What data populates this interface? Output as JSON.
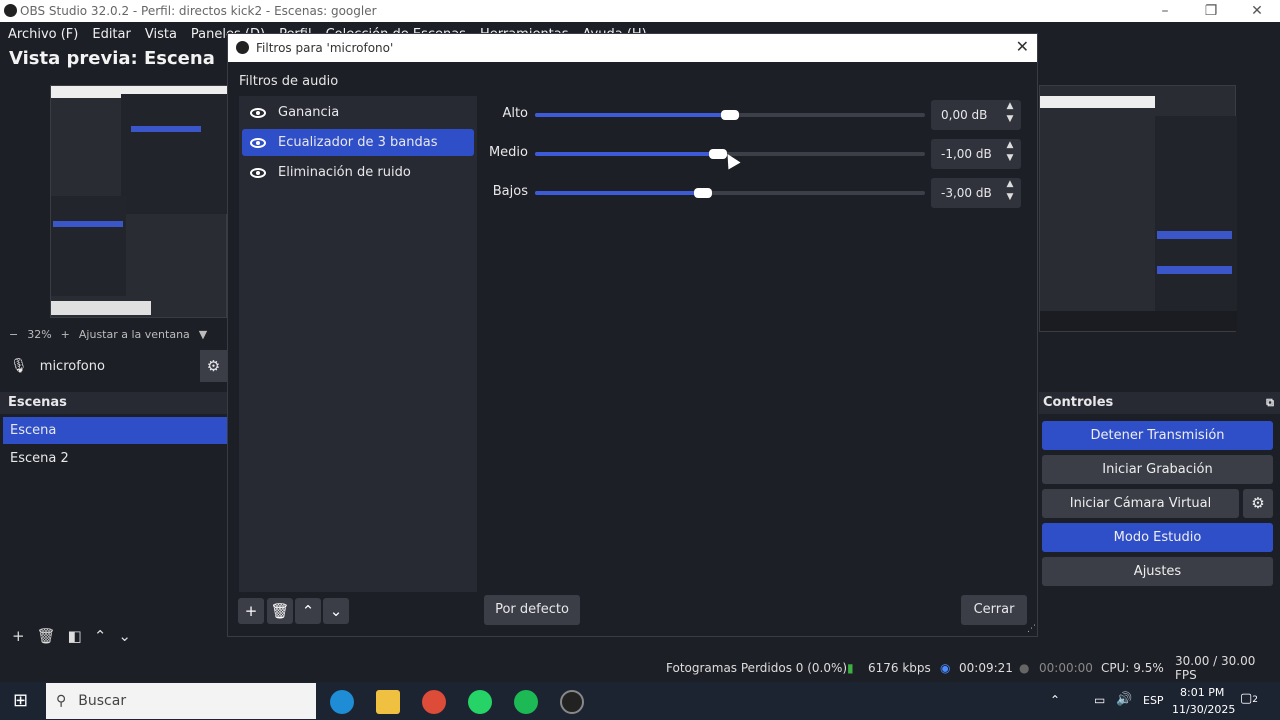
{
  "window": {
    "title": "OBS Studio 32.0.2 - Perfil: directos kick2 - Escenas: googler"
  },
  "menu": [
    "Archivo (F)",
    "Editar",
    "Vista",
    "Paneles (D)",
    "Perfil",
    "Colección de Escenas",
    "Herramientas",
    "Ayuda (H)"
  ],
  "preview": {
    "title": "Vista previa: Escena"
  },
  "zoom": {
    "minus": "−",
    "value": "32%",
    "plus": "+",
    "fit_label": "Ajustar a la ventana"
  },
  "source": {
    "name": "microfono"
  },
  "scenes": {
    "header": "Escenas",
    "items": [
      "Escena",
      "Escena 2"
    ],
    "selected": 0
  },
  "controls": {
    "header": "Controles",
    "buttons": [
      "Detener Transmisión",
      "Iniciar Grabación",
      "Iniciar Cámara Virtual",
      "Modo Estudio",
      "Ajustes"
    ]
  },
  "status": {
    "dropped": "Fotogramas Perdidos 0 (0.0%)",
    "bitrate": "6176 kbps",
    "live_time": "00:09:21",
    "rec_time": "00:00:00",
    "cpu": "CPU: 9.5%",
    "fps": "30.00 / 30.00 FPS"
  },
  "taskbar": {
    "search_placeholder": "Buscar",
    "lang": "ESP",
    "time": "8:01 PM",
    "date": "11/30/2025",
    "notif_count": "2"
  },
  "dialog": {
    "title": "Filtros para 'microfono'",
    "section": "Filtros de audio",
    "filters": [
      "Ganancia",
      "Ecualizador de 3 bandas",
      "Eliminación de ruido"
    ],
    "selected_filter": 1,
    "bands": [
      {
        "label": "Alto",
        "value_text": "0,00 dB",
        "level": 0.5
      },
      {
        "label": "Medio",
        "value_text": "-1,00 dB",
        "level": 0.47
      },
      {
        "label": "Bajos",
        "value_text": "-3,00 dB",
        "level": 0.43
      }
    ],
    "default_button": "Por defecto",
    "close_button": "Cerrar"
  },
  "colors": {
    "accent": "#2f4fc9",
    "bg": "#1d1f26",
    "panel": "#272a33"
  }
}
